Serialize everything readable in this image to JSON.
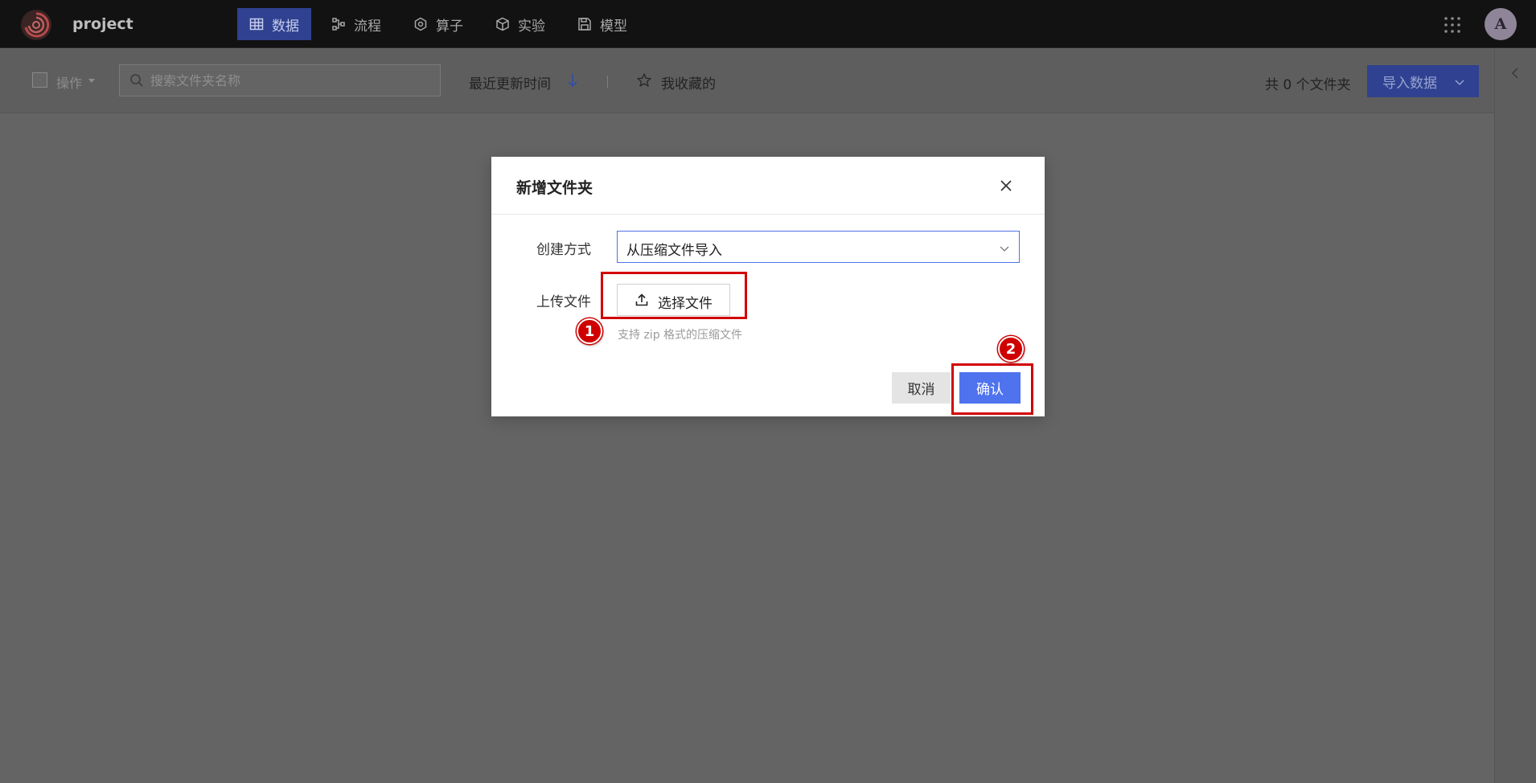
{
  "app": {
    "project_name": "project",
    "nav_items": [
      {
        "label": "数据",
        "icon": "table-icon",
        "active": true
      },
      {
        "label": "流程",
        "icon": "workflow-icon",
        "active": false
      },
      {
        "label": "算子",
        "icon": "operator-icon",
        "active": false
      },
      {
        "label": "实验",
        "icon": "cube-icon",
        "active": false
      },
      {
        "label": "模型",
        "icon": "save-icon",
        "active": false
      }
    ],
    "avatar_initial": "A",
    "accent_color": "#4f73ee"
  },
  "toolbar": {
    "ops_label": "操作",
    "search_placeholder": "搜索文件夹名称",
    "sort_label": "最近更新时间",
    "favorites_label": "我收藏的",
    "count_text": "共 0 个文件夹",
    "import_label": "导入数据"
  },
  "dialog": {
    "title": "新增文件夹",
    "create_method_label": "创建方式",
    "create_method_value": "从压缩文件导入",
    "upload_label": "上传文件",
    "upload_button_label": "选择文件",
    "upload_hint": "支持 zip 格式的压缩文件",
    "cancel_label": "取消",
    "confirm_label": "确认"
  },
  "annotations": {
    "step1": "1",
    "step2": "2",
    "highlight_color": "#d20000"
  }
}
